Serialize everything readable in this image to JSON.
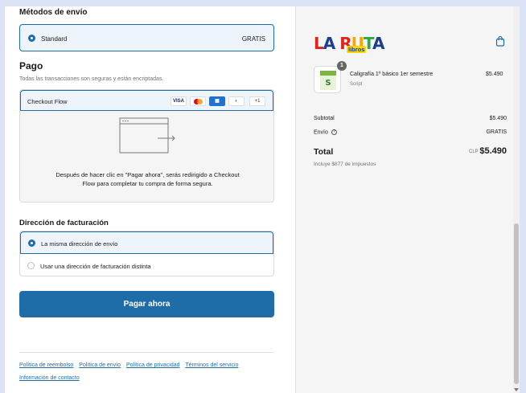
{
  "shipping": {
    "title": "Métodos de envío",
    "option_label": "Standard",
    "option_price": "GRATIS"
  },
  "payment": {
    "title": "Pago",
    "subtitle": "Todas las transacciones son seguras y están encriptadas.",
    "provider": "Checkout Flow",
    "cards": [
      "VISA",
      "",
      "",
      "",
      "+1"
    ],
    "info": "Después de hacer clic en \"Pagar ahora\", serás redirigido a Checkout Flow para completar tu compra de forma segura."
  },
  "billing": {
    "title": "Dirección de facturación",
    "option_same": "La misma dirección de envío",
    "option_other": "Usar una dirección de facturación distinta"
  },
  "pay_button": "Pagar ahora",
  "footer_links": [
    "Política de reembolso",
    "Política de envío",
    "Política de privacidad",
    "Términos del servicio",
    "Información de contacto"
  ],
  "store": {
    "logo_text": "LA RUTA",
    "logo_sub": "libros"
  },
  "cart": {
    "item": {
      "quantity": "1",
      "name": "Caligrafía 1º básico 1er semestre",
      "variant": "Script",
      "price": "$5.490"
    },
    "subtotal_label": "Subtotal",
    "subtotal_value": "$5.490",
    "shipping_label": "Envío",
    "shipping_value": "GRATIS",
    "total_label": "Total",
    "total_currency": "CLP",
    "total_value": "$5.490",
    "tax_note": "Incluye $877 de impuestos"
  },
  "colors": {
    "accent": "#1e6ca8",
    "selected_bg": "#eef4fb",
    "sidebar_bg": "#f5f5f5"
  }
}
